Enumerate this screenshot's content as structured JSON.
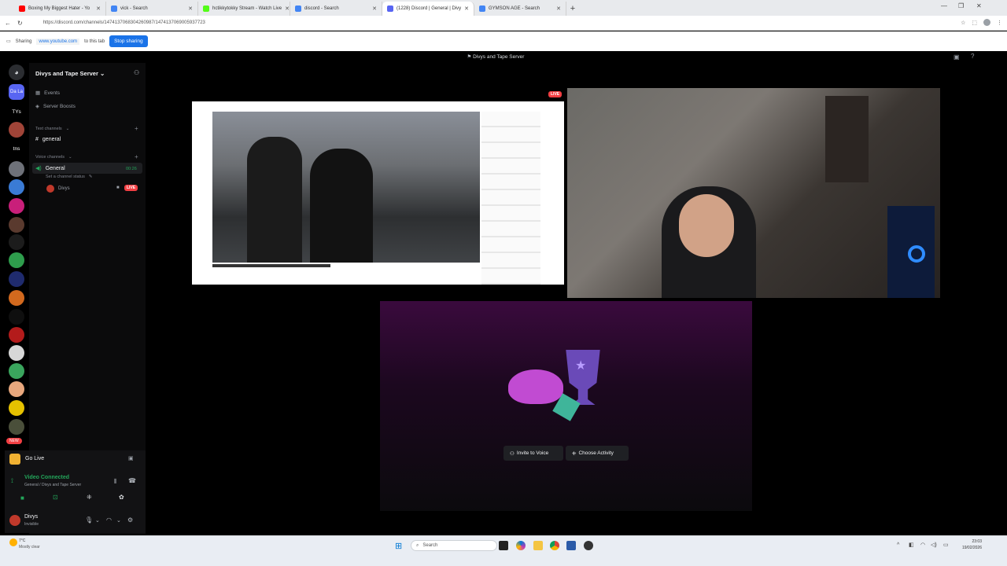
{
  "browser": {
    "tabs": [
      {
        "title": "Boxing My Biggest Hater - Yo",
        "color": "#ff0000",
        "active": false
      },
      {
        "title": "vick - Search",
        "color": "#4285f4",
        "active": false
      },
      {
        "title": "hctikkytokky Stream - Watch Live",
        "color": "#53fc18",
        "active": false
      },
      {
        "title": "discord - Search",
        "color": "#4285f4",
        "active": false
      },
      {
        "title": "(1228) Discord | General | Divy",
        "color": "#5865f2",
        "active": true
      },
      {
        "title": "GYMSON AGE - Search",
        "color": "#4285f4",
        "active": false
      }
    ],
    "url": "https://discord.com/channels/1474137068304260987/1474137069005937723",
    "share_label_prefix": "Sharing",
    "share_url": "www.youtube.com",
    "share_label_suffix": "to this tab",
    "stop_sharing_label": "Stop sharing"
  },
  "discord": {
    "window_title": "Divys and Tape Server",
    "server_name": "Divys and Tape Server",
    "nav_items": [
      "Events",
      "Server Boosts"
    ],
    "text_category": "Text channels",
    "text_channel": "general",
    "voice_category": "Voice channels",
    "voice_channel": "General",
    "voice_timer": "00:26",
    "channel_status": "Set a channel status",
    "voice_member": "Divys",
    "live_badge": "LIVE",
    "rail_labels": [
      "Da La",
      "TYs",
      "tns"
    ],
    "new_badge": "NEW",
    "go_live_label": "Go Live",
    "video_connected": "Video Connected",
    "video_connected_sub": "General / Divys and Tape Server",
    "username": "Divys",
    "user_status": "Invisible",
    "invite_label": "Invite to Voice",
    "activity_label": "Choose Activity",
    "tile_live": "LIVE",
    "accent": "#23a55a",
    "live_color": "#f23f43"
  },
  "taskbar": {
    "search_placeholder": "Search",
    "weather_temp": "7°C",
    "weather_desc": "Mostly clear",
    "time": "23:03",
    "date": "19/02/2026"
  }
}
